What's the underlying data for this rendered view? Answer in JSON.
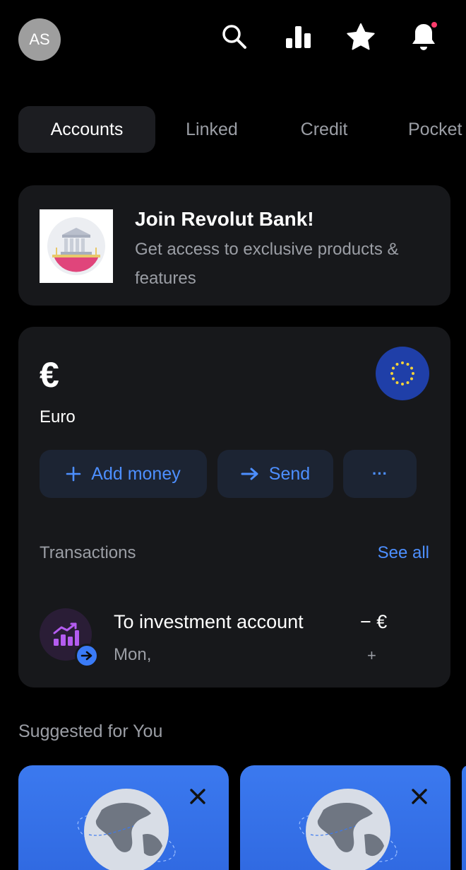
{
  "header": {
    "avatar_initials": "AS",
    "icons": [
      "search-icon",
      "chart-icon",
      "star-icon",
      "bell-icon"
    ],
    "notification_dot_color": "#ff3b6b"
  },
  "tabs": [
    {
      "label": "Accounts",
      "active": true
    },
    {
      "label": "Linked",
      "active": false
    },
    {
      "label": "Credit",
      "active": false
    },
    {
      "label": "Pocket",
      "active": false
    }
  ],
  "join_card": {
    "title": "Join Revolut Bank!",
    "subtitle": "Get access to exclusive products & features"
  },
  "account": {
    "currency_symbol": "€",
    "name": "Euro",
    "actions": {
      "add_money": "Add money",
      "send": "Send",
      "more": "···"
    },
    "transactions_title": "Transactions",
    "see_all": "See all",
    "transaction": {
      "name": "To investment account",
      "date": "Mon,",
      "amount": "− €",
      "sub": "+"
    }
  },
  "suggested": {
    "title": "Suggested for You"
  },
  "colors": {
    "accent": "#4d8fff",
    "card": "#17181b",
    "background": "#000000",
    "suggest_card": "#3b79ef"
  }
}
